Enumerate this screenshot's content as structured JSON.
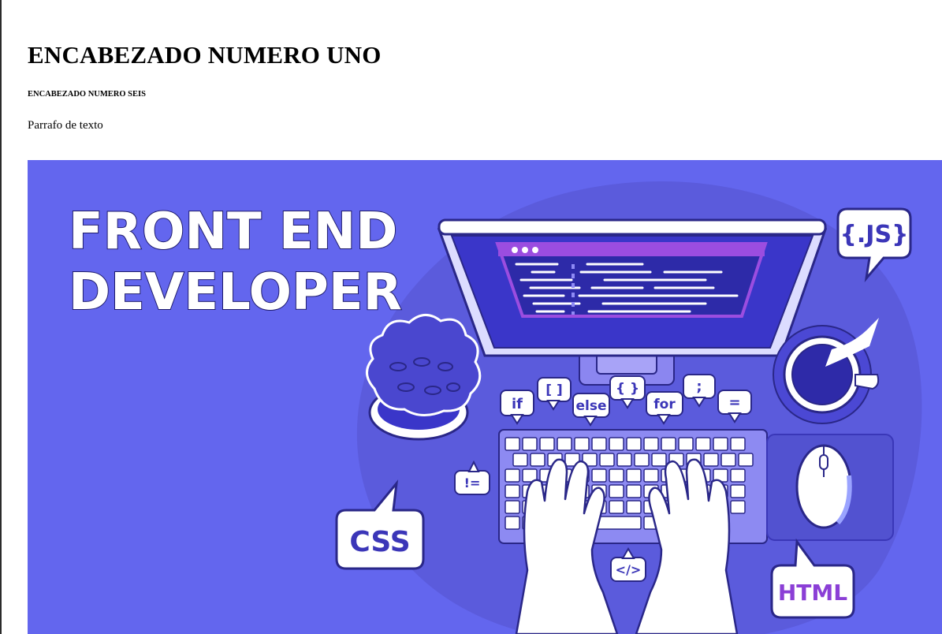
{
  "heading_1": "ENCABEZADO NUMERO UNO",
  "heading_6": "ENCABEZADO NUMERO SEIS",
  "paragraph": "Parrafo de texto",
  "hero": {
    "title_line_1": "FRONT END",
    "title_line_2": "DEVELOPER",
    "bubbles": {
      "js": "{.JS}",
      "css": "CSS",
      "html": "HTML",
      "if": "if",
      "brackets": "[ ]",
      "else": "else",
      "braces": "{ }",
      "for": "for",
      "semicolon": ";",
      "equals": "=",
      "not_equal": "!=",
      "tag": "</>"
    },
    "colors": {
      "background": "#6366ee",
      "blob": "#5a5ad9",
      "outline": "#2a2788",
      "screen": "#3a36c9",
      "accent_purple": "#9b4de0"
    }
  }
}
